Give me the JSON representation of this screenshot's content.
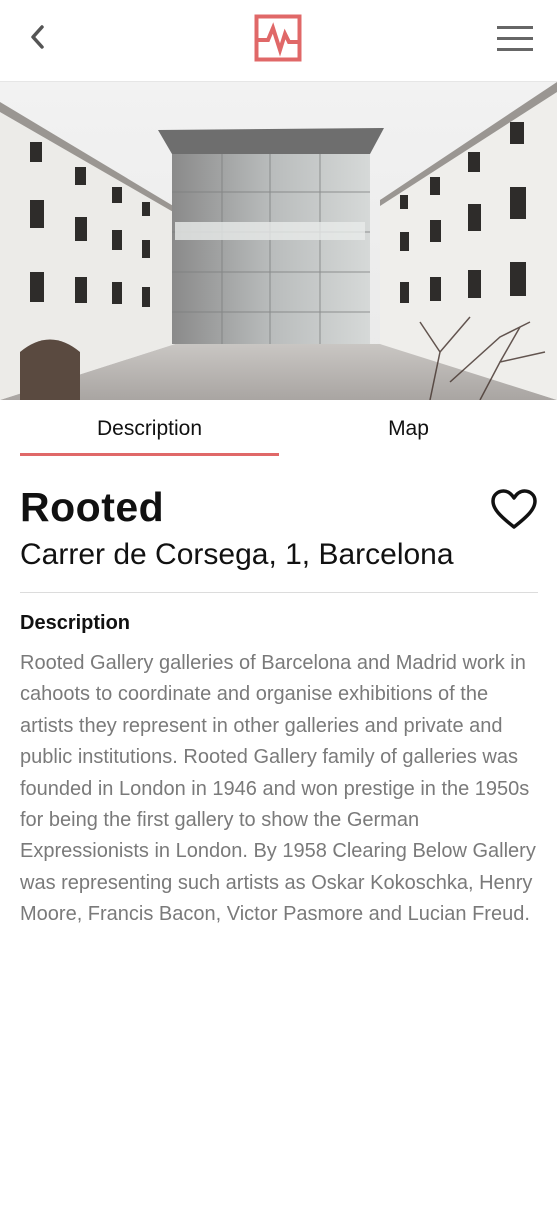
{
  "header": {
    "back_icon": "chevron-left-icon",
    "logo_icon": "pulse-logo-icon",
    "menu_icon": "hamburger-menu-icon",
    "brand_color": "#e06868"
  },
  "hero": {
    "image_alt": "Courtyard with glass facade building"
  },
  "tabs": [
    {
      "label": "Description",
      "active": true
    },
    {
      "label": "Map",
      "active": false
    }
  ],
  "venue": {
    "name": "Rooted",
    "address": "Carrer de Corsega, 1, Barcelona",
    "favorite_icon": "heart-outline-icon"
  },
  "description": {
    "heading": "Description",
    "text": "Rooted Gallery galleries of Barcelona and Madrid work in cahoots to coordinate and organise exhibitions of the artists they represent in other galleries and private and public institutions. Rooted Gallery family of galleries was founded in London in 1946 and won prestige in the 1950s for being the first gallery to show the German Expressionists in London. By 1958 Clearing Below Gallery was representing such artists as Oskar Kokoschka, Henry Moore, Francis Bacon, Victor Pasmore and Lucian Freud."
  }
}
